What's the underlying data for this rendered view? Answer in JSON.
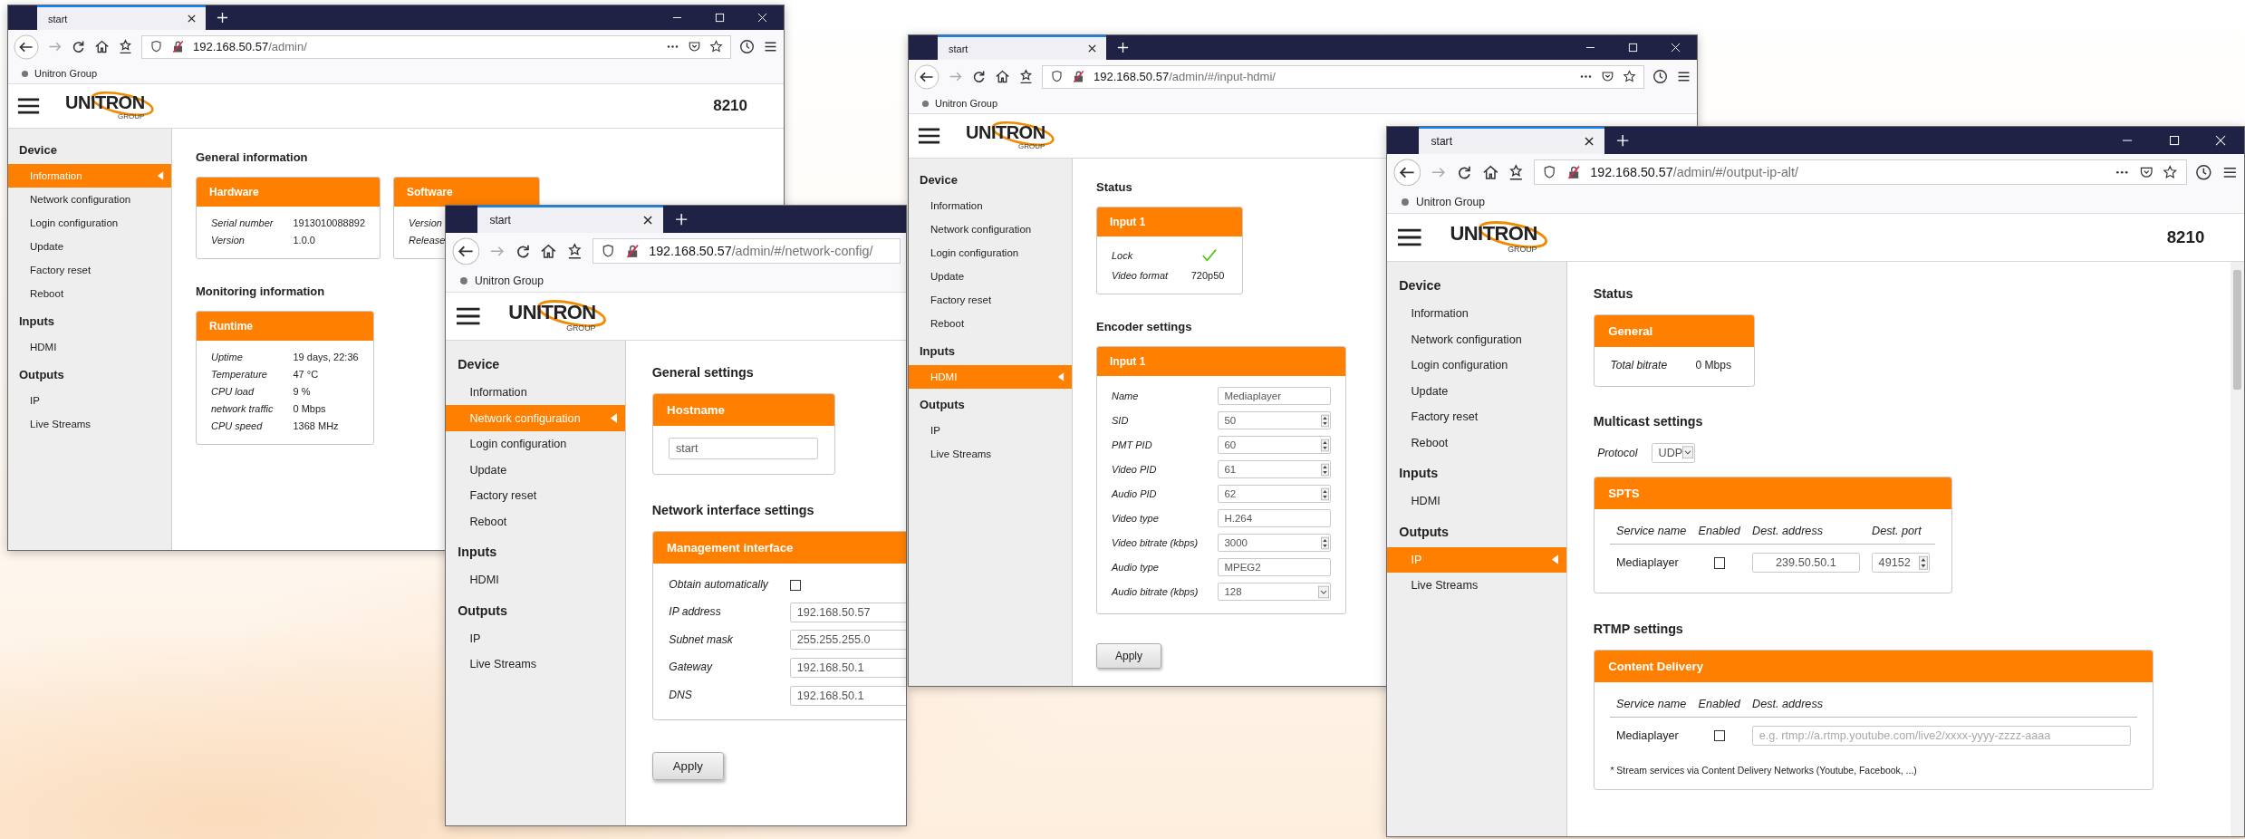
{
  "windows": [
    {
      "tab_title": "start",
      "full_toolbar": true,
      "url": {
        "host": "192.168.50.57",
        "path": "/admin/"
      },
      "bookmark": "Unitron Group",
      "logo": {
        "name": "UNITRON",
        "sub": "GROUP"
      },
      "model": "8210",
      "sidebar": [
        {
          "heading": "Device",
          "items": [
            {
              "label": "Information",
              "selected": true
            },
            {
              "label": "Network configuration",
              "selected": false
            },
            {
              "label": "Login configuration",
              "selected": false
            },
            {
              "label": "Update",
              "selected": false
            },
            {
              "label": "Factory reset",
              "selected": false
            },
            {
              "label": "Reboot",
              "selected": false
            }
          ]
        },
        {
          "heading": "Inputs",
          "items": [
            {
              "label": "HDMI",
              "selected": false
            }
          ]
        },
        {
          "heading": "Outputs",
          "items": [
            {
              "label": "IP",
              "selected": false
            },
            {
              "label": "Live Streams",
              "selected": false
            }
          ]
        }
      ],
      "content": [
        {
          "kind": "heading",
          "text": "General information"
        },
        {
          "kind": "cards",
          "cards": [
            {
              "title": "Hardware",
              "rows": [
                {
                  "label": "Serial number",
                  "value": "1913010088892"
                },
                {
                  "label": "Version",
                  "value": "1.0.0"
                }
              ]
            },
            {
              "title": "Software",
              "rows": [
                {
                  "label": "Version"
                },
                {
                  "label": "Release"
                }
              ]
            }
          ]
        },
        {
          "kind": "heading",
          "text": "Monitoring information"
        },
        {
          "kind": "cards",
          "cards": [
            {
              "title": "Runtime",
              "rows": [
                {
                  "label": "Uptime",
                  "value": "19 days, 22:36"
                },
                {
                  "label": "Temperature",
                  "value": "47 °C"
                },
                {
                  "label": "CPU load",
                  "value": "9 %"
                },
                {
                  "label": "network traffic",
                  "value": "0 Mbps"
                },
                {
                  "label": "CPU speed",
                  "value": "1368 MHz"
                }
              ]
            }
          ]
        }
      ]
    },
    {
      "tab_title": "start",
      "full_toolbar": false,
      "url": {
        "host": "192.168.50.57",
        "path": "/admin/#/network-config/"
      },
      "bookmark": "Unitron Group",
      "logo": {
        "name": "UNITRON",
        "sub": "GROUP"
      },
      "sidebar": [
        {
          "heading": "Device",
          "items": [
            {
              "label": "Information",
              "selected": false
            },
            {
              "label": "Network configuration",
              "selected": true
            },
            {
              "label": "Login configuration",
              "selected": false
            },
            {
              "label": "Update",
              "selected": false
            },
            {
              "label": "Factory reset",
              "selected": false
            },
            {
              "label": "Reboot",
              "selected": false
            }
          ]
        },
        {
          "heading": "Inputs",
          "items": [
            {
              "label": "HDMI",
              "selected": false
            }
          ]
        },
        {
          "heading": "Outputs",
          "items": [
            {
              "label": "IP",
              "selected": false
            },
            {
              "label": "Live Streams",
              "selected": false
            }
          ]
        }
      ],
      "content": [
        {
          "kind": "heading",
          "text": "General settings"
        },
        {
          "kind": "cards",
          "cards": [
            {
              "title": "Hostname",
              "rows": [
                {
                  "control": {
                    "kind": "text",
                    "value": "start"
                  }
                }
              ]
            }
          ]
        },
        {
          "kind": "heading",
          "text": "Network interface settings"
        },
        {
          "kind": "cards",
          "cards": [
            {
              "title": "Management interface",
              "rows": [
                {
                  "label": "Obtain automatically",
                  "control": {
                    "kind": "checkbox",
                    "checked": false
                  }
                },
                {
                  "label": "IP address",
                  "control": {
                    "kind": "text",
                    "value": "192.168.50.57"
                  }
                },
                {
                  "label": "Subnet mask",
                  "control": {
                    "kind": "text",
                    "value": "255.255.255.0"
                  }
                },
                {
                  "label": "Gateway",
                  "control": {
                    "kind": "text",
                    "value": "192.168.50.1"
                  }
                },
                {
                  "label": "DNS",
                  "control": {
                    "kind": "text",
                    "value": "192.168.50.1"
                  }
                }
              ]
            }
          ]
        },
        {
          "kind": "button",
          "label": "Apply"
        }
      ]
    },
    {
      "tab_title": "start",
      "full_toolbar": true,
      "url": {
        "host": "192.168.50.57",
        "path": "/admin/#/input-hdmi/"
      },
      "bookmark": "Unitron Group",
      "logo": {
        "name": "UNITRON",
        "sub": "GROUP"
      },
      "sidebar": [
        {
          "heading": "Device",
          "items": [
            {
              "label": "Information",
              "selected": false
            },
            {
              "label": "Network configuration",
              "selected": false
            },
            {
              "label": "Login configuration",
              "selected": false
            },
            {
              "label": "Update",
              "selected": false
            },
            {
              "label": "Factory reset",
              "selected": false
            },
            {
              "label": "Reboot",
              "selected": false
            }
          ]
        },
        {
          "heading": "Inputs",
          "items": [
            {
              "label": "HDMI",
              "selected": true
            }
          ]
        },
        {
          "heading": "Outputs",
          "items": [
            {
              "label": "IP",
              "selected": false
            },
            {
              "label": "Live Streams",
              "selected": false
            }
          ]
        }
      ],
      "content": [
        {
          "kind": "heading",
          "text": "Status"
        },
        {
          "kind": "cards",
          "cards": [
            {
              "title": "Input 1",
              "rows": [
                {
                  "label": "Lock",
                  "ok": true
                },
                {
                  "label": "Video format",
                  "value": "720p50"
                }
              ]
            }
          ]
        },
        {
          "kind": "heading",
          "text": "Encoder settings"
        },
        {
          "kind": "cards",
          "cards": [
            {
              "title": "Input 1",
              "rows": [
                {
                  "label": "Name",
                  "control": {
                    "kind": "text",
                    "value": "Mediaplayer"
                  }
                },
                {
                  "label": "SID",
                  "control": {
                    "kind": "spin",
                    "value": "50"
                  }
                },
                {
                  "label": "PMT PID",
                  "control": {
                    "kind": "spin",
                    "value": "60"
                  }
                },
                {
                  "label": "Video PID",
                  "control": {
                    "kind": "spin",
                    "value": "61"
                  }
                },
                {
                  "label": "Audio PID",
                  "control": {
                    "kind": "spin",
                    "value": "62"
                  }
                },
                {
                  "label": "Video type",
                  "control": {
                    "kind": "text",
                    "value": "H.264"
                  }
                },
                {
                  "label": "Video bitrate (kbps)",
                  "control": {
                    "kind": "spin",
                    "value": "3000"
                  }
                },
                {
                  "label": "Audio type",
                  "control": {
                    "kind": "text",
                    "value": "MPEG2"
                  }
                },
                {
                  "label": "Audio bitrate (kbps)",
                  "control": {
                    "kind": "select",
                    "value": "128"
                  }
                }
              ]
            }
          ]
        },
        {
          "kind": "button",
          "label": "Apply"
        }
      ]
    },
    {
      "tab_title": "start",
      "full_toolbar": true,
      "url": {
        "host": "192.168.50.57",
        "path": "/admin/#/output-ip-alt/"
      },
      "bookmark": "Unitron Group",
      "logo": {
        "name": "UNITRON",
        "sub": "GROUP"
      },
      "model": "8210",
      "sidebar": [
        {
          "heading": "Device",
          "items": [
            {
              "label": "Information",
              "selected": false
            },
            {
              "label": "Network configuration",
              "selected": false
            },
            {
              "label": "Login configuration",
              "selected": false
            },
            {
              "label": "Update",
              "selected": false
            },
            {
              "label": "Factory reset",
              "selected": false
            },
            {
              "label": "Reboot",
              "selected": false
            }
          ]
        },
        {
          "heading": "Inputs",
          "items": [
            {
              "label": "HDMI",
              "selected": false
            }
          ]
        },
        {
          "heading": "Outputs",
          "items": [
            {
              "label": "IP",
              "selected": true
            },
            {
              "label": "Live Streams",
              "selected": false
            }
          ]
        }
      ],
      "content": [
        {
          "kind": "heading",
          "text": "Status"
        },
        {
          "kind": "cards",
          "cards": [
            {
              "title": "General",
              "rows": [
                {
                  "label": "Total bitrate",
                  "value": "0 Mbps"
                }
              ]
            }
          ]
        },
        {
          "kind": "heading",
          "text": "Multicast settings"
        },
        {
          "kind": "field",
          "label": "Protocol",
          "control": {
            "kind": "select",
            "value": "UDP"
          }
        },
        {
          "kind": "cards",
          "cards": [
            {
              "title": "SPTS",
              "table": {
                "columns": [
                  "Service name",
                  "Enabled",
                  "Dest. address",
                  "Dest. port"
                ],
                "rows": [
                  [
                    {
                      "kind": "label",
                      "value": "Mediaplayer"
                    },
                    {
                      "kind": "checkbox",
                      "checked": false
                    },
                    {
                      "kind": "text",
                      "value": "239.50.50.1"
                    },
                    {
                      "kind": "spin",
                      "value": "49152"
                    }
                  ]
                ]
              }
            }
          ]
        },
        {
          "kind": "heading",
          "text": "RTMP settings"
        },
        {
          "kind": "cards",
          "cards": [
            {
              "title": "Content Delivery",
              "table": {
                "columns": [
                  "Service name",
                  "Enabled",
                  "Dest. address"
                ],
                "rows": [
                  [
                    {
                      "kind": "label",
                      "value": "Mediaplayer"
                    },
                    {
                      "kind": "checkbox",
                      "checked": false
                    },
                    {
                      "kind": "text",
                      "placeholder": "e.g. rtmp://a.rtmp.youtube.com/live2/xxxx-yyyy-zzzz-aaaa"
                    }
                  ]
                ]
              },
              "note": "* Stream services via Content Delivery Networks (Youtube, Facebook, ...)"
            }
          ]
        }
      ]
    }
  ]
}
